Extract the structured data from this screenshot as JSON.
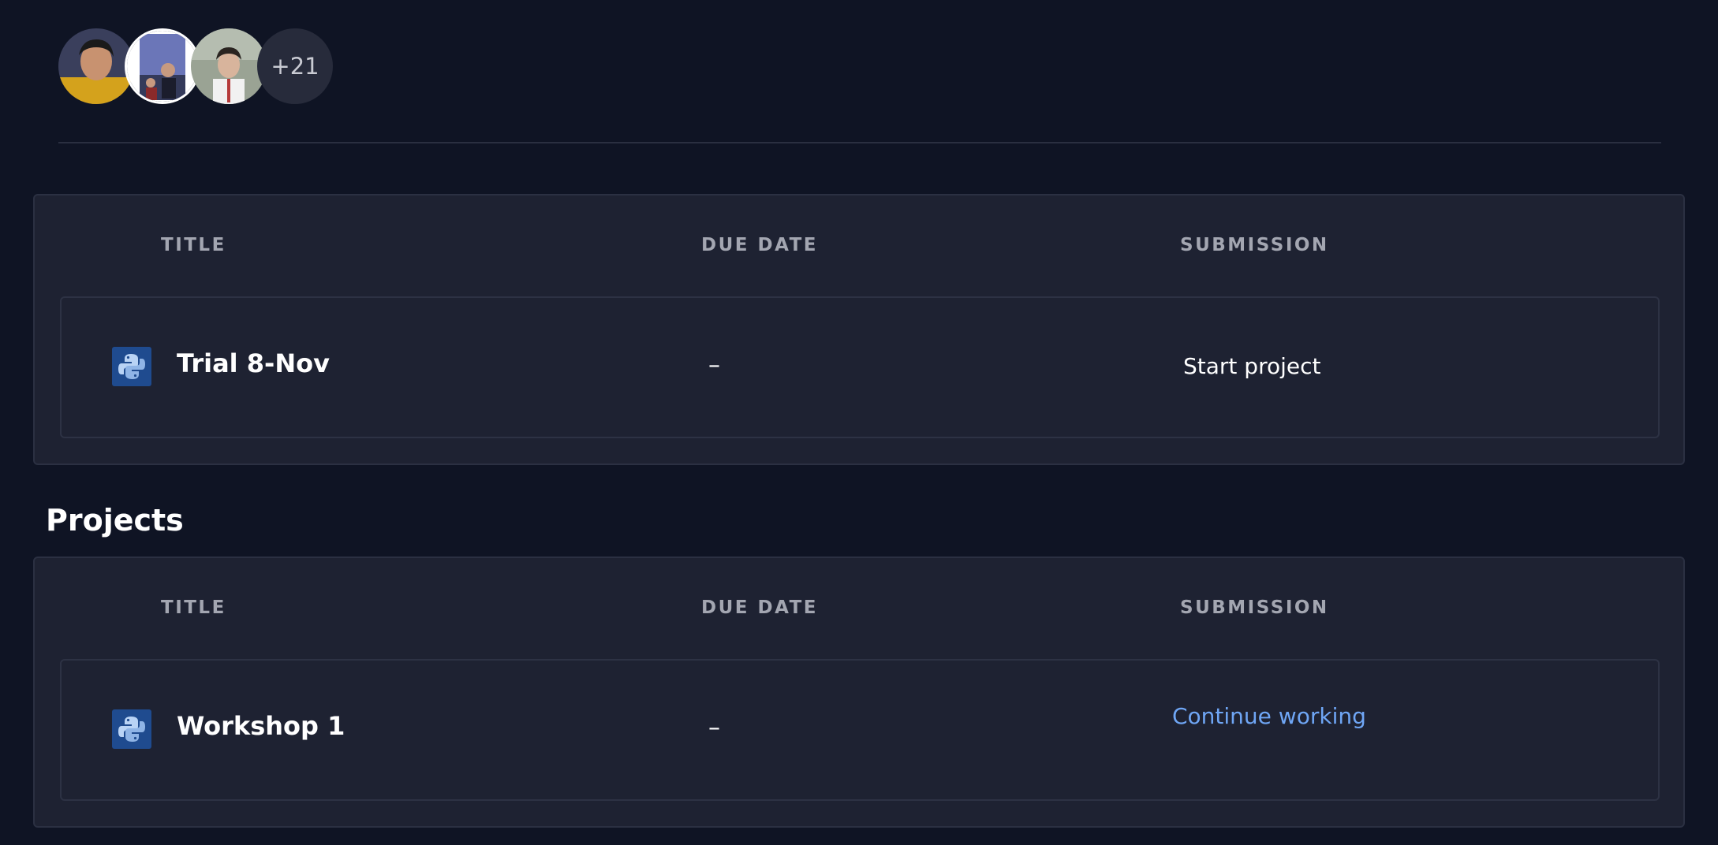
{
  "members": {
    "avatars": [
      {
        "name": "member-1"
      },
      {
        "name": "member-2"
      },
      {
        "name": "member-3"
      }
    ],
    "more_count": "+21"
  },
  "assignments": {
    "headers": {
      "title": "TITLE",
      "due_date": "DUE DATE",
      "submission": "SUBMISSION"
    },
    "rows": [
      {
        "icon": "python-icon",
        "title": "Trial 8-Nov",
        "due_date": "–",
        "submission": "Start project"
      }
    ]
  },
  "projects": {
    "section_title": "Projects",
    "headers": {
      "title": "TITLE",
      "due_date": "DUE DATE",
      "submission": "SUBMISSION"
    },
    "rows": [
      {
        "icon": "python-icon",
        "title": "Workshop 1",
        "due_date": "–",
        "submission": "Continue working"
      }
    ]
  },
  "colors": {
    "background": "#0f1424",
    "card": "#1e2232",
    "link": "#6fa6f5",
    "python_blue": "#1f4b8f"
  }
}
